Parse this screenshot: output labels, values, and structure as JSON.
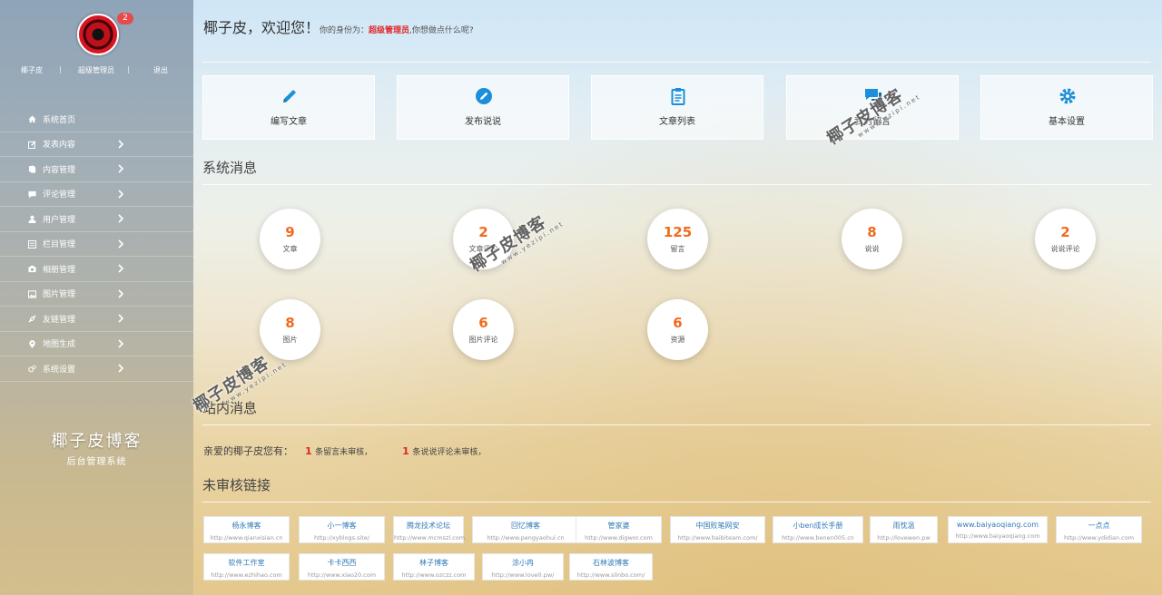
{
  "sidebar": {
    "badge": "2",
    "user": {
      "name": "椰子皮",
      "sep1": "|",
      "role": "超级管理员",
      "sep2": "|",
      "logout": "退出"
    },
    "items": [
      {
        "label": "系统首页",
        "icon": "home-icon"
      },
      {
        "label": "发表内容",
        "icon": "edit-icon"
      },
      {
        "label": "内容管理",
        "icon": "book-icon"
      },
      {
        "label": "评论管理",
        "icon": "comment-icon"
      },
      {
        "label": "用户管理",
        "icon": "user-icon"
      },
      {
        "label": "栏目管理",
        "icon": "list-icon"
      },
      {
        "label": "相册管理",
        "icon": "camera-icon"
      },
      {
        "label": "图片管理",
        "icon": "image-icon"
      },
      {
        "label": "友链管理",
        "icon": "link-icon"
      },
      {
        "label": "地图生成",
        "icon": "map-marker-icon"
      },
      {
        "label": "系统设置",
        "icon": "cogs-icon"
      }
    ],
    "brand_title": "椰子皮博客",
    "brand_sub": "后台管理系统"
  },
  "header": {
    "greeting": "椰子皮，欢迎您！",
    "identity_prefix": "你的身份为：",
    "role": "超级管理员",
    "question": ",你想做点什么呢?"
  },
  "quick": [
    {
      "label": "编写文章",
      "icon": "pencil-icon"
    },
    {
      "label": "发布说说",
      "icon": "edit-circle-icon"
    },
    {
      "label": "文章列表",
      "icon": "clipboard-icon"
    },
    {
      "label": "我的留言",
      "icon": "chat-icon"
    },
    {
      "label": "基本设置",
      "icon": "gear-icon"
    }
  ],
  "sections": {
    "system": "系统消息",
    "inbox": "站内消息",
    "pending_links": "未审核链接"
  },
  "stats": [
    {
      "num": "9",
      "label": "文章"
    },
    {
      "num": "2",
      "label": "文章评论"
    },
    {
      "num": "125",
      "label": "留言"
    },
    {
      "num": "8",
      "label": "说说"
    },
    {
      "num": "2",
      "label": "说说评论"
    },
    {
      "num": "8",
      "label": "图片"
    },
    {
      "num": "6",
      "label": "图片评论"
    },
    {
      "num": "6",
      "label": "资源"
    }
  ],
  "notice": {
    "prefix": "亲爱的椰子皮您有：",
    "n1": "1",
    "t1": "条留言未审核，",
    "n2": "1",
    "t2": "条说说评论未审核，"
  },
  "links": [
    {
      "name": "杨永博客",
      "url": "http://www.qianxisian.cn"
    },
    {
      "name": "小一博客",
      "url": "http://xyblogs.site/"
    },
    {
      "name": "腾龙技术论坛",
      "url": "http://www.mcmszl.com"
    },
    {
      "name": "回忆博客",
      "url": "http://www.pengyaohui.cn"
    },
    {
      "name": "管家婆",
      "url": "http://www.digwor.com"
    },
    {
      "name": "中国败笔网安",
      "url": "http://www.baibiteam.com/"
    },
    {
      "name": "小ben成长手册",
      "url": "http://www.benen005.cn"
    },
    {
      "name": "雨忱温",
      "url": "http://lovewen.pw"
    },
    {
      "name": "www.baiyaoqiang.com",
      "url": "http://www.baiyaoqiang.com"
    },
    {
      "name": "一点点",
      "url": "http://www.ydidian.com"
    },
    {
      "name": "软件工作室",
      "url": "http://www.ezhihao.com"
    },
    {
      "name": "卡卡西西",
      "url": "http://www.xiao20.com"
    },
    {
      "name": "林子博客",
      "url": "http://www.ozczz.com"
    },
    {
      "name": "涂小冉",
      "url": "http://www.love0.pw/"
    },
    {
      "name": "石林波博客",
      "url": "http://www.slinbo.com/"
    }
  ],
  "watermark": {
    "text": "椰子皮博客",
    "url": "www.yezipi.net"
  },
  "colors": {
    "accent": "#1b8fd9",
    "stat_number": "#f26a1b",
    "alert": "#e0262a",
    "link": "#337ab7"
  }
}
